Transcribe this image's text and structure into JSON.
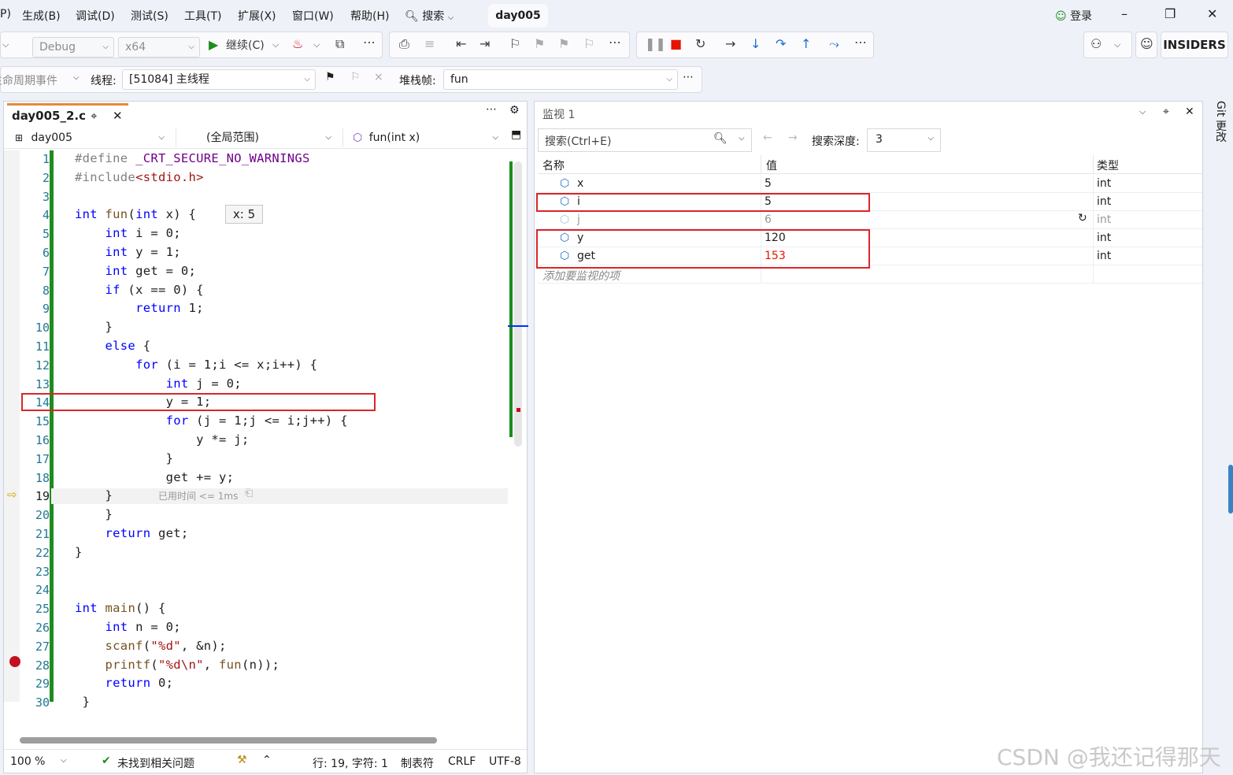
{
  "menubar": {
    "items": [
      "P)",
      "生成(B)",
      "调试(D)",
      "测试(S)",
      "工具(T)",
      "扩展(X)",
      "窗口(W)",
      "帮助(H)"
    ],
    "search_label": "搜索",
    "solution_title": "day005",
    "login_label": "登录"
  },
  "toolbar": {
    "config": "Debug",
    "platform": "x64",
    "continue_label": "继续(C)",
    "insiders_label": "INSIDERS"
  },
  "locbar": {
    "lifecycle_label": "生命周期事件",
    "thread_label": "线程:",
    "thread_value": "[51084] 主线程",
    "stackframe_label": "堆栈帧:",
    "stackframe_value": "fun"
  },
  "editor": {
    "tab_title": "day005_2.c",
    "project": "day005",
    "scope": "(全局范围)",
    "function": "fun(int x)",
    "hover_tip": "x: 5",
    "elapsed_hint": "已用时间 <= 1ms",
    "line_numbers": [
      "1",
      "2",
      "3",
      "4",
      "5",
      "6",
      "7",
      "8",
      "9",
      "10",
      "11",
      "12",
      "13",
      "14",
      "15",
      "16",
      "17",
      "18",
      "19",
      "20",
      "21",
      "22",
      "23",
      "24",
      "25",
      "26",
      "27",
      "28",
      "29",
      "30"
    ],
    "current_line": 19,
    "breakpoint_line": 28,
    "highlight_line": 14
  },
  "code_lines": [
    "#define _CRT_SECURE_NO_WARNINGS",
    "#include<stdio.h>",
    "",
    "int fun(int x) {",
    "    int i = 0;",
    "    int y = 1;",
    "    int get = 0;",
    "    if (x == 0) {",
    "        return 1;",
    "    }",
    "    else {",
    "        for (i = 1;i <= x;i++) {",
    "            int j = 0;",
    "            y = 1;",
    "            for (j = 1;j <= i;j++) {",
    "                y *= j;",
    "            }",
    "            get += y;",
    "    }",
    "    }",
    "    return get;",
    "}",
    "",
    "",
    "int main() {",
    "    int n = 0;",
    "    scanf(\"%d\", &n);",
    "    printf(\"%d\\n\", fun(n));",
    "    return 0;",
    " }"
  ],
  "editor_status": {
    "zoom": "100 %",
    "issues": "未找到相关问题",
    "position": "行: 19, 字符: 1",
    "indent": "制表符",
    "eol": "CRLF",
    "encoding": "UTF-8"
  },
  "watch": {
    "title": "监视 1",
    "search_placeholder": "搜索(Ctrl+E)",
    "depth_label": "搜索深度:",
    "depth_value": "3",
    "columns": [
      "名称",
      "值",
      "类型"
    ],
    "rows": [
      {
        "name": "x",
        "value": "5",
        "type": "int"
      },
      {
        "name": "i",
        "value": "5",
        "type": "int"
      },
      {
        "name": "j",
        "value": "6",
        "type": "int"
      },
      {
        "name": "y",
        "value": "120",
        "type": "int"
      },
      {
        "name": "get",
        "value": "153",
        "type": "int"
      }
    ],
    "add_placeholder": "添加要监视的项",
    "side_tab": "Git 更改"
  },
  "watermark": "CSDN @我还记得那天",
  "colors": {
    "accent_red": "#d9262b",
    "changed_value": "#e51400",
    "keyword": "#0000ff",
    "green_bar": "#1e8c1e"
  }
}
